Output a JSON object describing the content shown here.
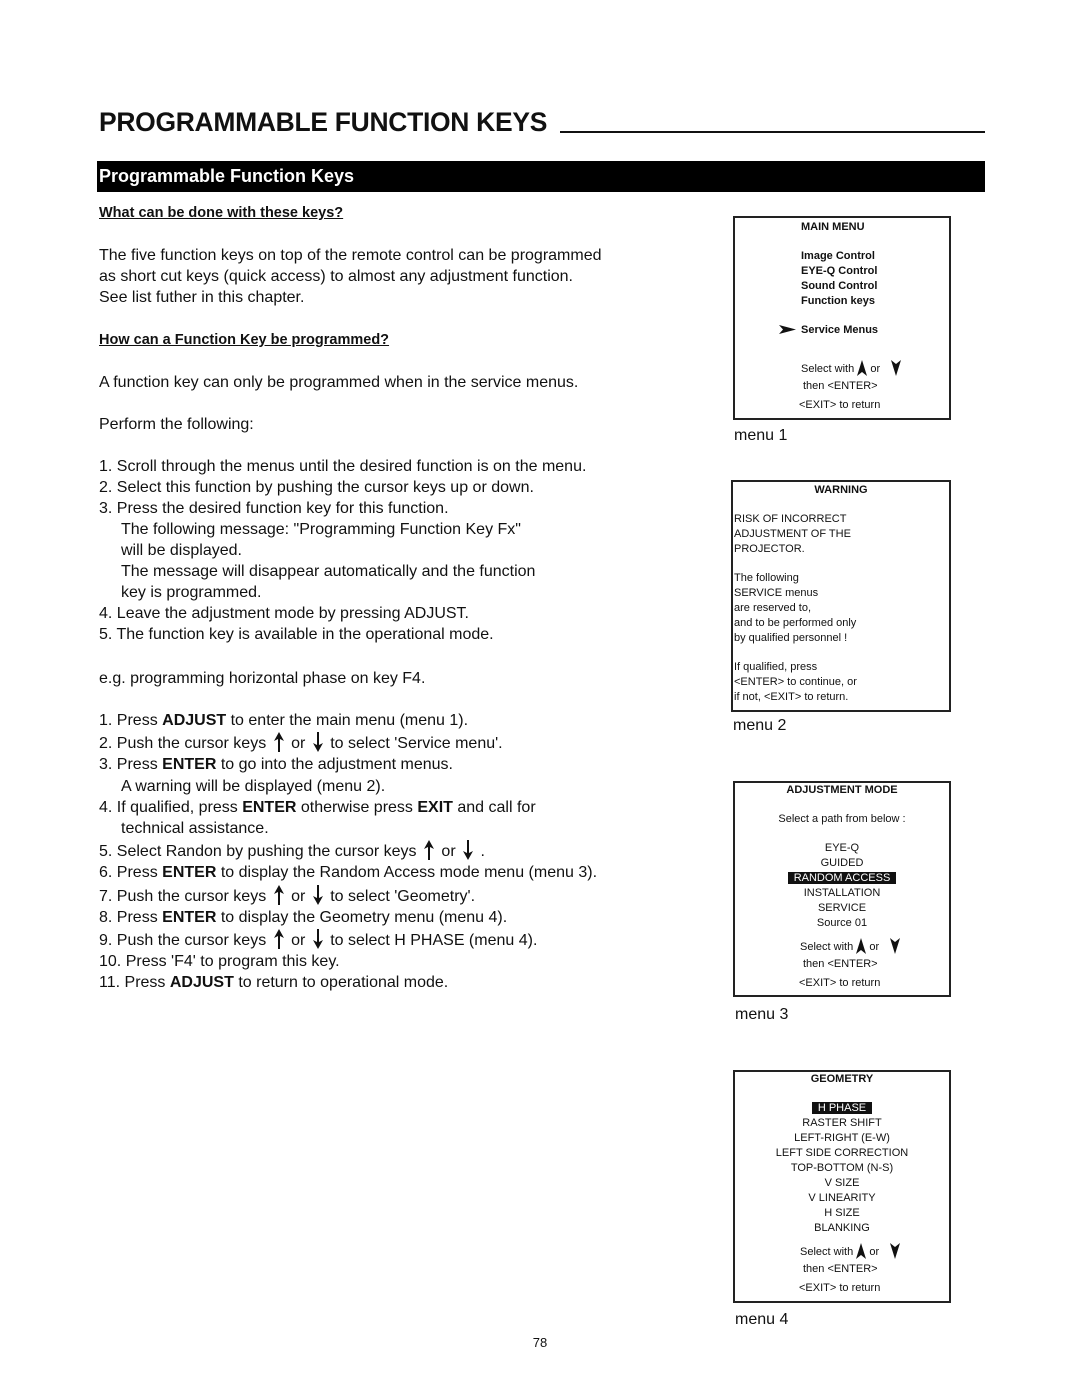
{
  "page": {
    "title": "PROGRAMMABLE FUNCTION KEYS",
    "section_bar": "Programmable Function Keys",
    "page_number": "78"
  },
  "intro": {
    "heading": "What can be done with these keys?",
    "lines": [
      "The five function keys on top of the remote control can be programmed",
      "as short cut keys (quick access) to almost any adjustment function.",
      "See list futher in this chapter."
    ]
  },
  "howto": {
    "heading": "How can a Function Key be programmed?",
    "note": "A function key can only be programmed when in the service menus.",
    "perform": "Perform the following:",
    "steps": [
      {
        "num": "1.",
        "text": "Scroll through the menus until the desired function is on the menu."
      },
      {
        "num": "2.",
        "text": "Select this function by pushing the cursor keys up or down."
      },
      {
        "num": "3.",
        "text": "Press the desired function key for this function."
      },
      {
        "num": "",
        "text": "The following message: \"Programming Function Key Fx\""
      },
      {
        "num": "",
        "text": "will be displayed."
      },
      {
        "num": "",
        "text": "The message will disappear automatically and the function"
      },
      {
        "num": "",
        "text": "key is programmed."
      },
      {
        "num": "4.",
        "text": "Leave the adjustment mode by pressing ADJUST."
      },
      {
        "num": "5.",
        "text": "The function key is available in the operational mode."
      }
    ],
    "example": "e.g. programming horizontal phase on key F4."
  },
  "example_steps": {
    "s1": {
      "num": "1.",
      "pre": "Press ",
      "key": "ADJUST",
      "post": " to enter the main menu (menu 1)."
    },
    "s2": {
      "num": "2.",
      "pre": "Push the cursor keys ",
      "or": " or ",
      "post": " to select 'Service menu'."
    },
    "s3": {
      "num": "3.",
      "pre": "Press ",
      "key": "ENTER",
      "post": " to go into the adjustment menus."
    },
    "s3b": "A warning will be displayed (menu 2).",
    "s4": {
      "num": "4.",
      "pre": "If qualified, press ",
      "key": "ENTER",
      "mid": " otherwise press ",
      "key2": "EXIT",
      "post": " and call for"
    },
    "s4b": "technical assistance.",
    "s5": {
      "num": "5.",
      "pre": "Select Randon by pushing the cursor keys ",
      "or": " or ",
      "post": " ."
    },
    "s6": {
      "num": "6.",
      "pre": "Press ",
      "key": "ENTER",
      "post": " to display the Random Access mode menu (menu 3)."
    },
    "s7": {
      "num": "7.",
      "pre": "Push the cursor keys ",
      "or": " or ",
      "post": " to select 'Geometry'."
    },
    "s8": {
      "num": "8.",
      "pre": "Press ",
      "key": "ENTER",
      "post": " to display the Geometry menu (menu 4)."
    },
    "s9": {
      "num": "9.",
      "pre": "Push the cursor keys ",
      "or": " or ",
      "post": " to select H PHASE (menu 4)."
    },
    "s10": {
      "num": "10.",
      "text": "Press 'F4' to program this key."
    },
    "s11": {
      "num": "11.",
      "pre": "Press ",
      "key": "ADJUST",
      "post": " to return to operational mode."
    }
  },
  "menus": {
    "menu1": {
      "title": "MAIN MENU",
      "items": [
        "Image Control",
        "EYE-Q Control",
        "Sound Control",
        "Function keys"
      ],
      "pointer_item": "Service Menus",
      "select_with": "Select with",
      "or": "or",
      "then_enter": "then <ENTER>",
      "exit": "<EXIT> to return",
      "caption": "menu 1"
    },
    "menu2": {
      "title": "WARNING",
      "lines_a": [
        "RISK OF INCORRECT",
        "ADJUSTMENT OF THE",
        "PROJECTOR."
      ],
      "lines_b": [
        "The following",
        "SERVICE menus",
        "are reserved to,",
        "and to be performed only",
        "by qualified personnel !"
      ],
      "lines_c": [
        "If qualified, press",
        "<ENTER> to continue, or",
        "if not, <EXIT> to return."
      ],
      "caption": "menu 2"
    },
    "menu3": {
      "title": "ADJUSTMENT MODE",
      "prompt": "Select a path from below :",
      "items": [
        "EYE-Q",
        "GUIDED",
        "RANDOM ACCESS",
        "INSTALLATION",
        "SERVICE",
        "Source 01"
      ],
      "selected_index": 2,
      "select_with": "Select with",
      "or": "or",
      "then_enter": "then <ENTER>",
      "exit": "<EXIT> to return",
      "caption": "menu 3"
    },
    "menu4": {
      "title": "GEOMETRY",
      "items": [
        "H PHASE",
        "RASTER SHIFT",
        "LEFT-RIGHT (E-W)",
        "LEFT SIDE CORRECTION",
        "TOP-BOTTOM (N-S)",
        "V SIZE",
        "V LINEARITY",
        "H SIZE",
        "BLANKING"
      ],
      "selected_index": 0,
      "select_with": "Select with",
      "or": "or",
      "then_enter": "then <ENTER>",
      "exit": "<EXIT> to return",
      "caption": "menu 4"
    }
  }
}
